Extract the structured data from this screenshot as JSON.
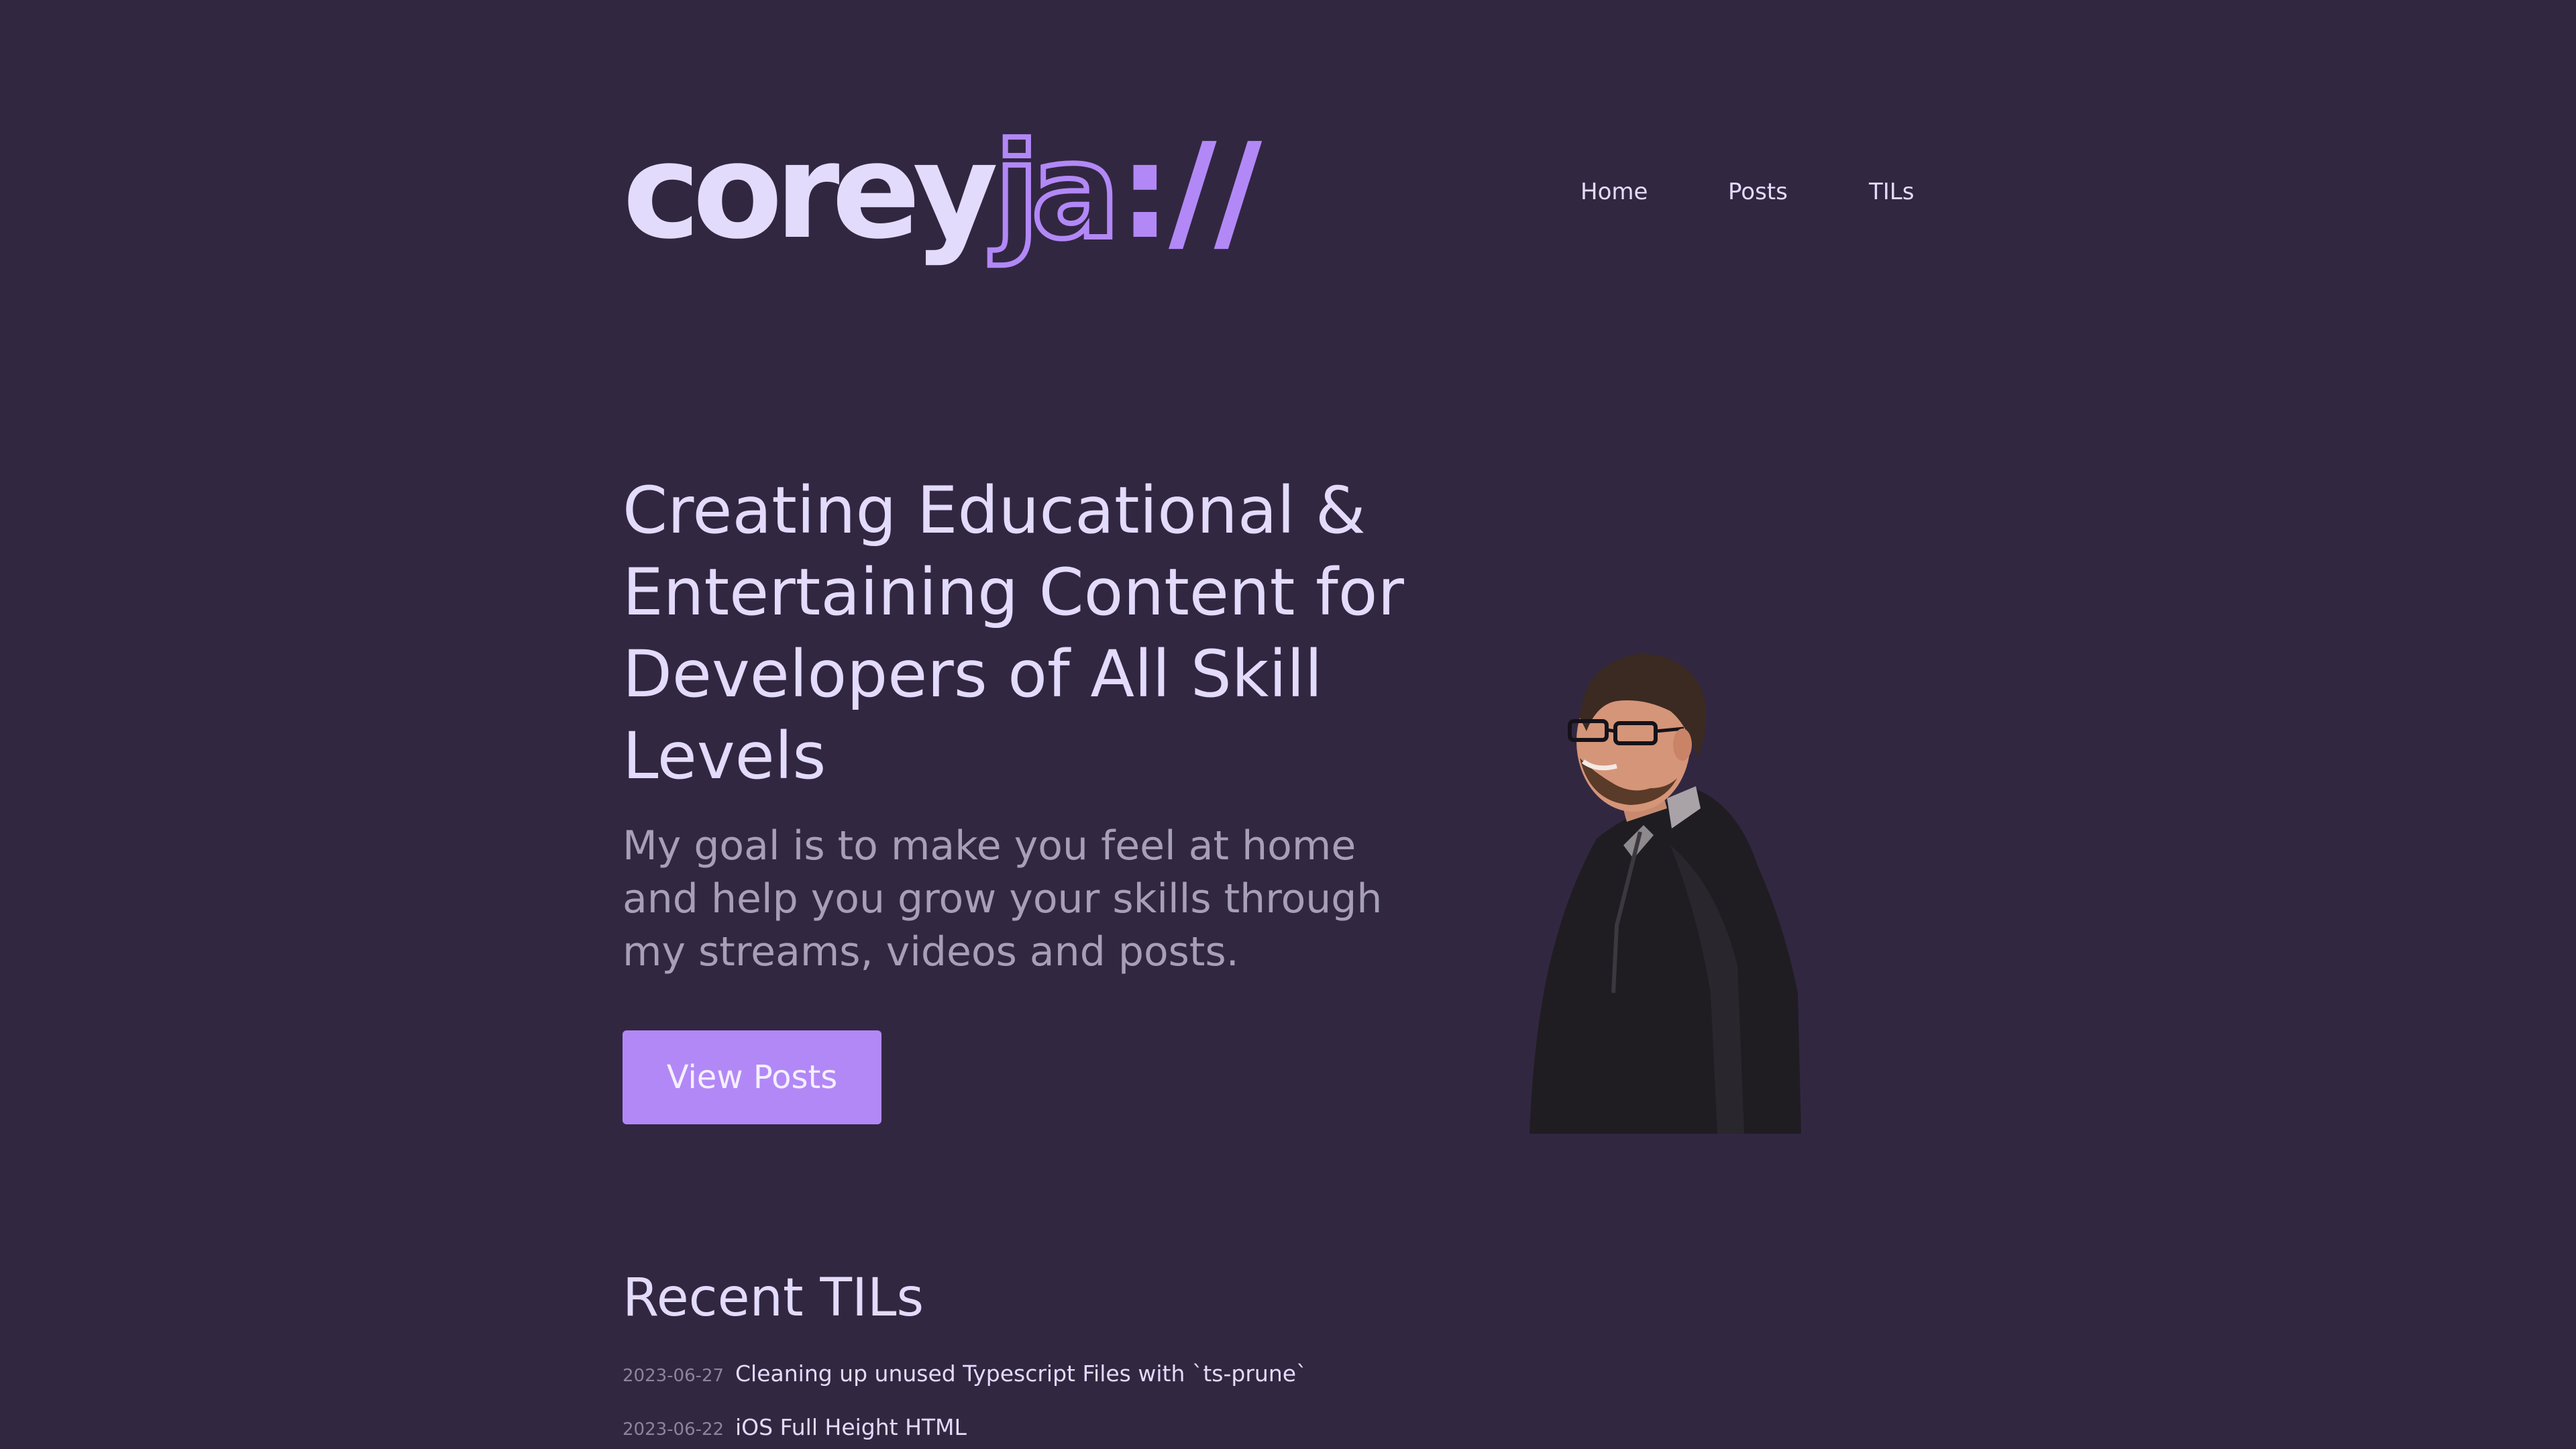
{
  "header": {
    "logo": {
      "part1": "corey",
      "part2": "ja",
      "part3": "://"
    },
    "nav": [
      {
        "label": "Home"
      },
      {
        "label": "Posts"
      },
      {
        "label": "TILs"
      }
    ]
  },
  "hero": {
    "title": "Creating Educational & Entertaining Content for Developers of All Skill Levels",
    "subtitle": "My goal is to make you feel at home and help you grow your skills through my streams, videos and posts.",
    "cta_label": "View Posts"
  },
  "recent": {
    "heading": "Recent TILs",
    "items": [
      {
        "date": "2023-06-27",
        "title": "Cleaning up unused Typescript Files with `ts-prune`"
      },
      {
        "date": "2023-06-22",
        "title": "iOS Full Height HTML"
      }
    ]
  },
  "colors": {
    "background": "#322741",
    "accent": "#b288f7",
    "text": "#e3dbfb",
    "muted": "#a79fb8"
  }
}
